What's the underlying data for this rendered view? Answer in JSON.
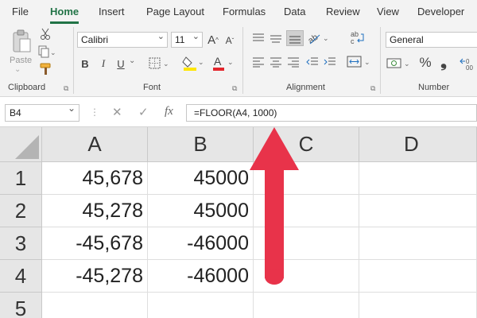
{
  "menu": {
    "tabs": [
      "File",
      "Home",
      "Insert",
      "Page Layout",
      "Formulas",
      "Data",
      "Review",
      "View",
      "Developer"
    ],
    "active": "Home"
  },
  "ribbon": {
    "clipboard": {
      "label": "Clipboard",
      "paste_label": "Paste"
    },
    "font": {
      "label": "Font",
      "name": "Calibri",
      "size": "11",
      "grow": "A",
      "shrink": "A",
      "bold": "B",
      "italic": "I",
      "underline": "U"
    },
    "alignment": {
      "label": "Alignment"
    },
    "number": {
      "label": "Number",
      "format": "General",
      "percent": "%"
    }
  },
  "formula_bar": {
    "name_box": "B4",
    "fx": "fx",
    "formula": "=FLOOR(A4, 1000)"
  },
  "grid": {
    "columns": [
      "A",
      "B",
      "C",
      "D"
    ],
    "rows": [
      {
        "num": "1",
        "a": "45,678",
        "b": "45000"
      },
      {
        "num": "2",
        "a": "45,278",
        "b": "45000"
      },
      {
        "num": "3",
        "a": "-45,678",
        "b": "-46000"
      },
      {
        "num": "4",
        "a": "-45,278",
        "b": "-46000"
      },
      {
        "num": "5",
        "a": "",
        "b": ""
      }
    ]
  },
  "colors": {
    "accent": "#217346",
    "arrow": "#e8334a"
  }
}
